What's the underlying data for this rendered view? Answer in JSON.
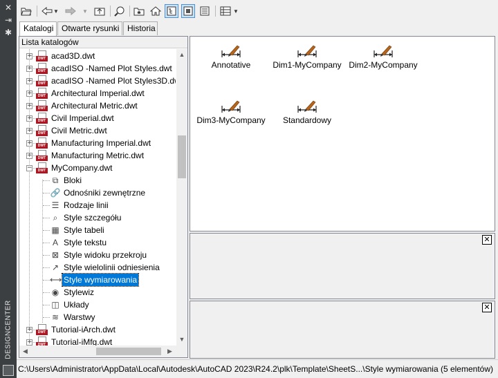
{
  "side_strip": {
    "title": "DESIGNCENTER",
    "icons": [
      "close-icon",
      "pin-icon",
      "settings-icon",
      "palette-icon"
    ]
  },
  "toolbar": {
    "buttons": [
      {
        "name": "load-icon",
        "glyph": "📂"
      },
      {
        "name": "back-icon",
        "glyph": "⇦"
      },
      {
        "name": "back-dropdown-icon",
        "glyph": "▼"
      },
      {
        "name": "forward-icon",
        "glyph": "⇨"
      },
      {
        "name": "forward-dropdown-icon",
        "glyph": "▼"
      },
      {
        "name": "up-icon",
        "glyph": "⬆"
      },
      {
        "name": "search-icon",
        "glyph": "🔍"
      },
      {
        "name": "favorites-icon",
        "glyph": "☆"
      },
      {
        "name": "home-icon",
        "glyph": "⌂"
      },
      {
        "name": "tree-view-toggle-icon",
        "glyph": "☷"
      },
      {
        "name": "preview-toggle-icon",
        "glyph": "▣"
      },
      {
        "name": "description-toggle-icon",
        "glyph": "☰"
      },
      {
        "name": "views-icon",
        "glyph": "▦"
      },
      {
        "name": "views-dropdown-icon",
        "glyph": "▼"
      }
    ]
  },
  "tabs": [
    {
      "label": "Katalogi",
      "active": true
    },
    {
      "label": "Otwarte rysunki",
      "active": false
    },
    {
      "label": "Historia",
      "active": false
    }
  ],
  "left_panel": {
    "header": "Lista katalogów",
    "tree": [
      {
        "label": "acad3D.dwt",
        "kind": "dwt",
        "expander": "+",
        "level": 0
      },
      {
        "label": "acadISO -Named Plot Styles.dwt",
        "kind": "dwt",
        "expander": "+",
        "level": 0
      },
      {
        "label": "acadISO -Named Plot Styles3D.dwt",
        "kind": "dwt",
        "expander": "+",
        "level": 0
      },
      {
        "label": "Architectural Imperial.dwt",
        "kind": "dwt",
        "expander": "+",
        "level": 0
      },
      {
        "label": "Architectural Metric.dwt",
        "kind": "dwt",
        "expander": "+",
        "level": 0
      },
      {
        "label": "Civil Imperial.dwt",
        "kind": "dwt",
        "expander": "+",
        "level": 0
      },
      {
        "label": "Civil Metric.dwt",
        "kind": "dwt",
        "expander": "+",
        "level": 0
      },
      {
        "label": "Manufacturing Imperial.dwt",
        "kind": "dwt",
        "expander": "+",
        "level": 0
      },
      {
        "label": "Manufacturing Metric.dwt",
        "kind": "dwt",
        "expander": "+",
        "level": 0
      },
      {
        "label": "MyCompany.dwt",
        "kind": "dwt",
        "expander": "−",
        "level": 0
      },
      {
        "label": "Bloki",
        "kind": "blocks-icon",
        "glyph": "⧉",
        "level": 1
      },
      {
        "label": "Odnośniki zewnętrzne",
        "kind": "xref-icon",
        "glyph": "🔗",
        "level": 1
      },
      {
        "label": "Rodzaje linii",
        "kind": "linetype-icon",
        "glyph": "☰",
        "level": 1
      },
      {
        "label": "Style szczegółu",
        "kind": "detail-style-icon",
        "glyph": "⌕",
        "level": 1
      },
      {
        "label": "Style tabeli",
        "kind": "table-style-icon",
        "glyph": "▦",
        "level": 1
      },
      {
        "label": "Style tekstu",
        "kind": "text-style-icon",
        "glyph": "A",
        "level": 1
      },
      {
        "label": "Style widoku przekroju",
        "kind": "section-view-style-icon",
        "glyph": "⊠",
        "level": 1
      },
      {
        "label": "Style wielolinii odniesienia",
        "kind": "multileader-style-icon",
        "glyph": "↗",
        "level": 1
      },
      {
        "label": "Style wymiarowania",
        "kind": "dimension-style-icon",
        "glyph": "⟷",
        "level": 1,
        "selected": true
      },
      {
        "label": "Stylewiz",
        "kind": "visual-style-icon",
        "glyph": "◉",
        "level": 1
      },
      {
        "label": "Układy",
        "kind": "layout-icon",
        "glyph": "◫",
        "level": 1
      },
      {
        "label": "Warstwy",
        "kind": "layers-icon",
        "glyph": "≋",
        "level": 1
      },
      {
        "label": "Tutorial-iArch.dwt",
        "kind": "dwt",
        "expander": "+",
        "level": 0
      },
      {
        "label": "Tutorial-iMfg.dwt",
        "kind": "dwt",
        "expander": "+",
        "level": 0
      }
    ]
  },
  "content": {
    "items": [
      {
        "label": "Annotative"
      },
      {
        "label": "Dim1-MyCompany"
      },
      {
        "label": "Dim2-MyCompany"
      },
      {
        "label": "Dim3-MyCompany"
      },
      {
        "label": "Standardowy"
      }
    ]
  },
  "close_glyph": "✕",
  "status": "C:\\Users\\Administrator\\AppData\\Local\\Autodesk\\AutoCAD 2023\\R24.2\\plk\\Template\\SheetS...\\Style wymiarowania (5 elementów)",
  "colors": {
    "selection": "#0078d7",
    "dwt_badge": "#b3141f",
    "dim_brush": "#b5651d",
    "strip": "#3c3f41"
  }
}
